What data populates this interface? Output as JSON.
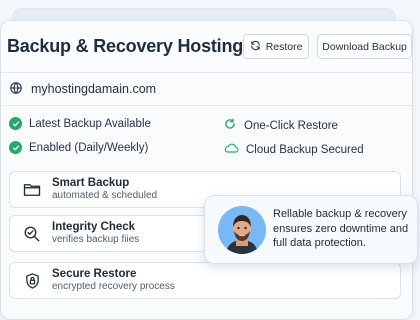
{
  "header": {
    "title": "Backup & Recovery Hosting",
    "restore_label": "Restore",
    "download_label": "Download Backup"
  },
  "site": {
    "domain": "myhostingdamain.com"
  },
  "status": {
    "latest_backup": "Latest Backup Available",
    "schedule": "Enabled (Daily/Weekly)",
    "one_click": "One-Click Restore",
    "cloud": "Cloud Backup Secured"
  },
  "features": [
    {
      "title": "Smart Backup",
      "subtitle": "automated & scheduled",
      "icon": "folder-icon"
    },
    {
      "title": "Integrity Check",
      "subtitle": "verifies backup fiies",
      "icon": "magnifier-check-icon"
    },
    {
      "title": "Secure Restore",
      "subtitle": "encrypted recovery process",
      "icon": "shield-lock-icon"
    }
  ],
  "testimonial": {
    "text": "Rellable backup & recovery ensures zero downtime and full data protection."
  },
  "colors": {
    "accent": "#28a96b",
    "panel": "#f9fbfd",
    "border": "#d6e1ec",
    "avatar_bg": "#78b8f6"
  }
}
